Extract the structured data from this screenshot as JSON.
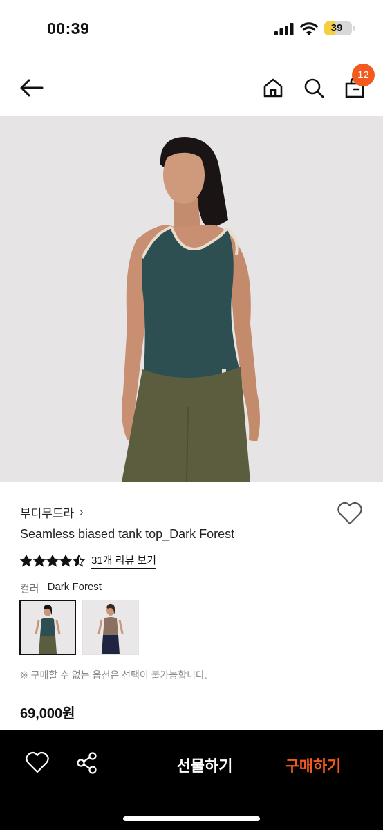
{
  "status_bar": {
    "time": "00:39",
    "battery_level": "39",
    "battery_percent": 39
  },
  "nav": {
    "back_icon": "arrow-left-icon",
    "home_icon": "home-icon",
    "search_icon": "search-icon",
    "cart_icon": "shopping-bag-icon",
    "cart_count": "12"
  },
  "product": {
    "brand": "부디무드라",
    "brand_chevron": "›",
    "title": "Seamless biased tank top_Dark Forest",
    "rating": 4.5,
    "review_link": "31개 리뷰 보기",
    "option_label": "컬러",
    "option_value": "Dark Forest",
    "swatches": [
      {
        "name": "Dark Forest",
        "top_color": "#2e4f52",
        "bottom_color": "#5b5d3e",
        "selected": true
      },
      {
        "name": "Taupe",
        "top_color": "#8b7060",
        "bottom_color": "#1f2540",
        "selected": false
      }
    ],
    "note": "※ 구매할 수 없는 옵션은 선택이 불가능합니다.",
    "price": "69,000원"
  },
  "bottom_bar": {
    "gift_label": "선물하기",
    "buy_label": "구매하기",
    "like_icon": "heart-outline-icon",
    "share_icon": "share-icon"
  },
  "colors": {
    "accent": "#f45a1e",
    "hero_bg": "#e6e4e5",
    "top_color": "#2e4f52",
    "pants_color": "#5b5d3e"
  }
}
